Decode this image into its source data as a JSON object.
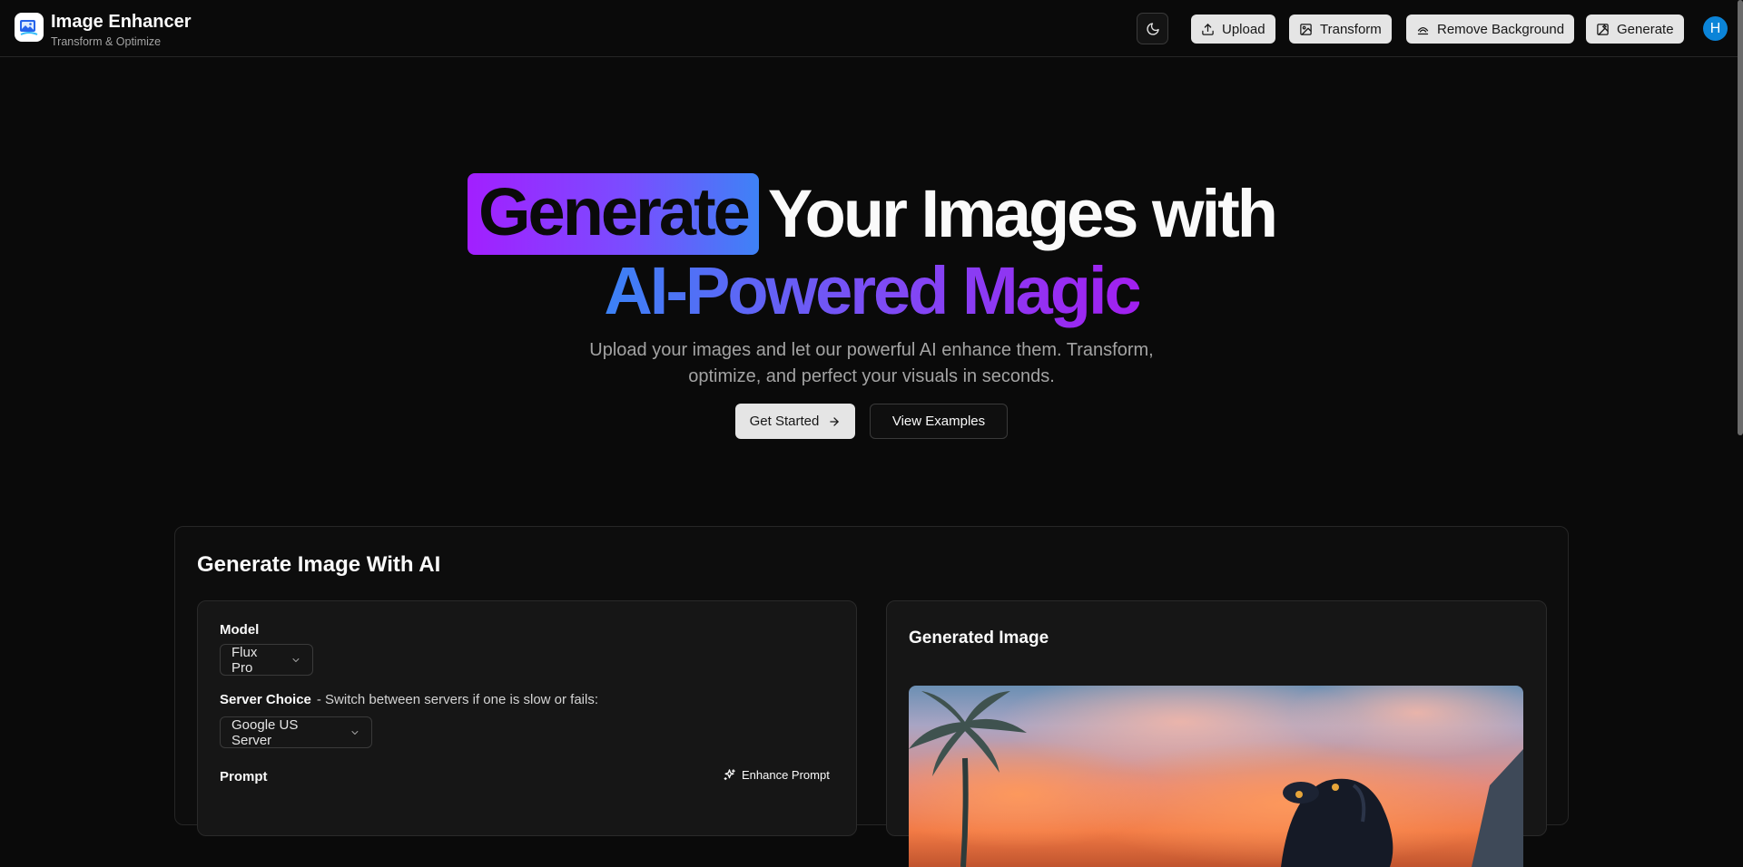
{
  "header": {
    "brand_title": "Image Enhancer",
    "brand_subtitle": "Transform & Optimize",
    "nav": [
      {
        "label": "Upload",
        "icon": "upload-icon"
      },
      {
        "label": "Transform",
        "icon": "transform-icon"
      },
      {
        "label": "Remove Background",
        "icon": "remove-background-icon"
      },
      {
        "label": "Generate",
        "icon": "generate-icon"
      }
    ],
    "avatar_initial": "H"
  },
  "hero": {
    "highlight": "Generate",
    "line1_rest": "Your Images with",
    "line2": "AI-Powered Magic",
    "description": "Upload your images and let our powerful AI enhance them. Transform, optimize, and perfect your visuals in seconds.",
    "primary_button": "Get Started",
    "secondary_button": "View Examples"
  },
  "generate": {
    "title": "Generate Image With AI",
    "model_label": "Model",
    "model_value": "Flux Pro",
    "server_label": "Server Choice",
    "server_hint": "- Switch between servers if one is slow or fails:",
    "server_value": "Google US Server",
    "prompt_label": "Prompt",
    "enhance_prompt": "Enhance Prompt",
    "output_title": "Generated Image"
  },
  "colors": {
    "background": "#0a0a0a",
    "accent_purple": "#a21fff",
    "accent_blue": "#3b82f6",
    "avatar": "#0b84d8"
  }
}
